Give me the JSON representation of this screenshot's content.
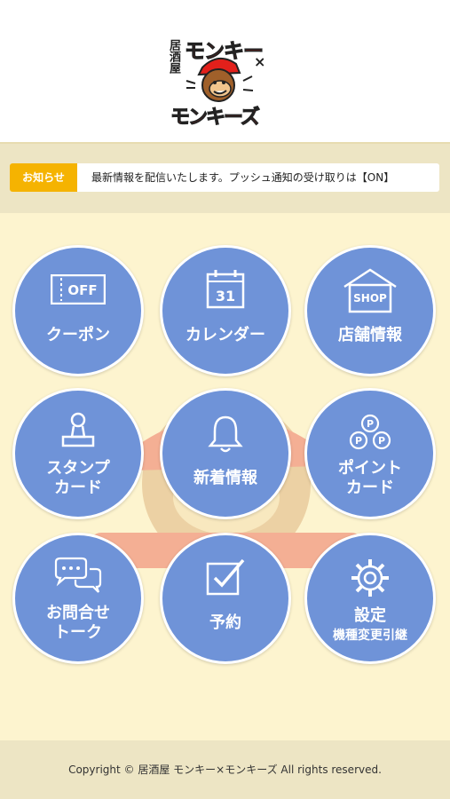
{
  "header": {
    "logo": {
      "prefix": "居酒屋",
      "line1": "モンキー",
      "cross": "×",
      "line2": "モンキーズ"
    }
  },
  "notice": {
    "badge": "お知らせ",
    "text": "最新情報を配信いたします。プッシュ通知の受け取りは【ON】"
  },
  "menu": [
    {
      "label": "クーポン",
      "icon": "coupon-off-icon",
      "icon_text": "OFF"
    },
    {
      "label": "カレンダー",
      "icon": "calendar-icon",
      "icon_text": "31"
    },
    {
      "label": "店舗情報",
      "icon": "shop-icon",
      "icon_text": "SHOP"
    },
    {
      "label1": "スタンプ",
      "label2": "カード",
      "icon": "stamp-icon"
    },
    {
      "label": "新着情報",
      "icon": "bell-icon"
    },
    {
      "label1": "ポイント",
      "label2": "カード",
      "icon": "point-coins-icon",
      "icon_text": "P"
    },
    {
      "label1": "お問合せ",
      "label2": "トーク",
      "icon": "chat-bubbles-icon"
    },
    {
      "label": "予約",
      "icon": "checkbox-icon"
    },
    {
      "label1": "設定",
      "label2": "機種変更引継",
      "icon": "gear-icon"
    }
  ],
  "footer": {
    "copyright": "Copyright © 居酒屋 モンキー×モンキーズ All rights reserved."
  },
  "colors": {
    "button": "#6f93d8",
    "badge": "#f5b301",
    "background": "#fdf4cf",
    "logo_red": "#e3201b"
  }
}
